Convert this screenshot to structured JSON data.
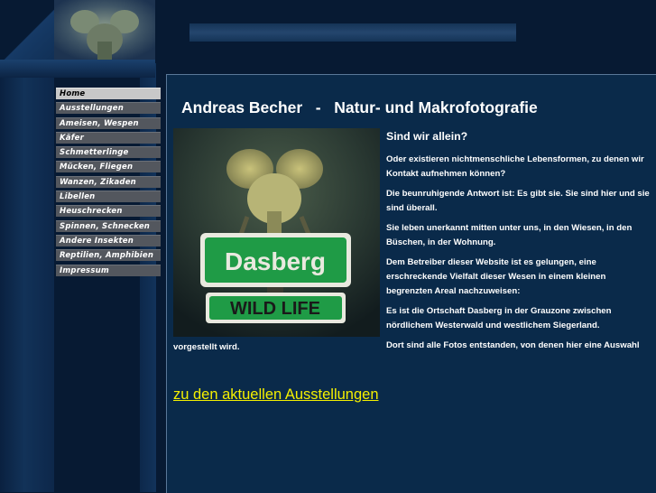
{
  "header": {
    "title": "Andreas Becher   -   Natur- und Makrofotografie"
  },
  "nav": {
    "items": [
      {
        "label": "Home",
        "active": true
      },
      {
        "label": "Ausstellungen"
      },
      {
        "label": "Ameisen, Wespen"
      },
      {
        "label": "Käfer"
      },
      {
        "label": "Schmetterlinge"
      },
      {
        "label": "Mücken, Fliegen"
      },
      {
        "label": "Wanzen, Zikaden"
      },
      {
        "label": "Libellen"
      },
      {
        "label": "Heuschrecken"
      },
      {
        "label": "Spinnen, Schnecken"
      },
      {
        "label": "Andere Insekten"
      },
      {
        "label": "Reptilien, Amphibien"
      },
      {
        "label": "Impressum"
      }
    ]
  },
  "photo": {
    "sign_top": "Dasberg",
    "sign_bottom": "WILD LIFE"
  },
  "content": {
    "heading": "Sind wir allein?",
    "paragraphs": [
      "Oder existieren nichtmenschliche Lebensformen, zu denen wir Kontakt aufnehmen können?",
      "Die beunruhigende Antwort ist: Es gibt sie. Sie sind hier und sie sind überall.",
      "Sie leben unerkannt mitten unter uns, in den Wiesen, in den Büschen, in der Wohnung.",
      "Dem Betreiber dieser Website ist es gelungen, eine erschreckende Vielfalt dieser Wesen in einem kleinen begrenzten Areal nachzuweisen:",
      "Es ist die Ortschaft Dasberg in der Grauzone zwischen nördlichem Westerwald und westlichem Siegerland.",
      "Dort sind alle Fotos entstanden, von denen hier eine Auswahl"
    ],
    "tail": "vorgestellt wird.",
    "link": "zu den aktuellen Ausstellungen"
  },
  "colors": {
    "background": "#071a33",
    "panel": "#0a2a4a",
    "link": "#f5f000",
    "nav_button": "#53575e",
    "nav_active": "#c8c8c8"
  }
}
